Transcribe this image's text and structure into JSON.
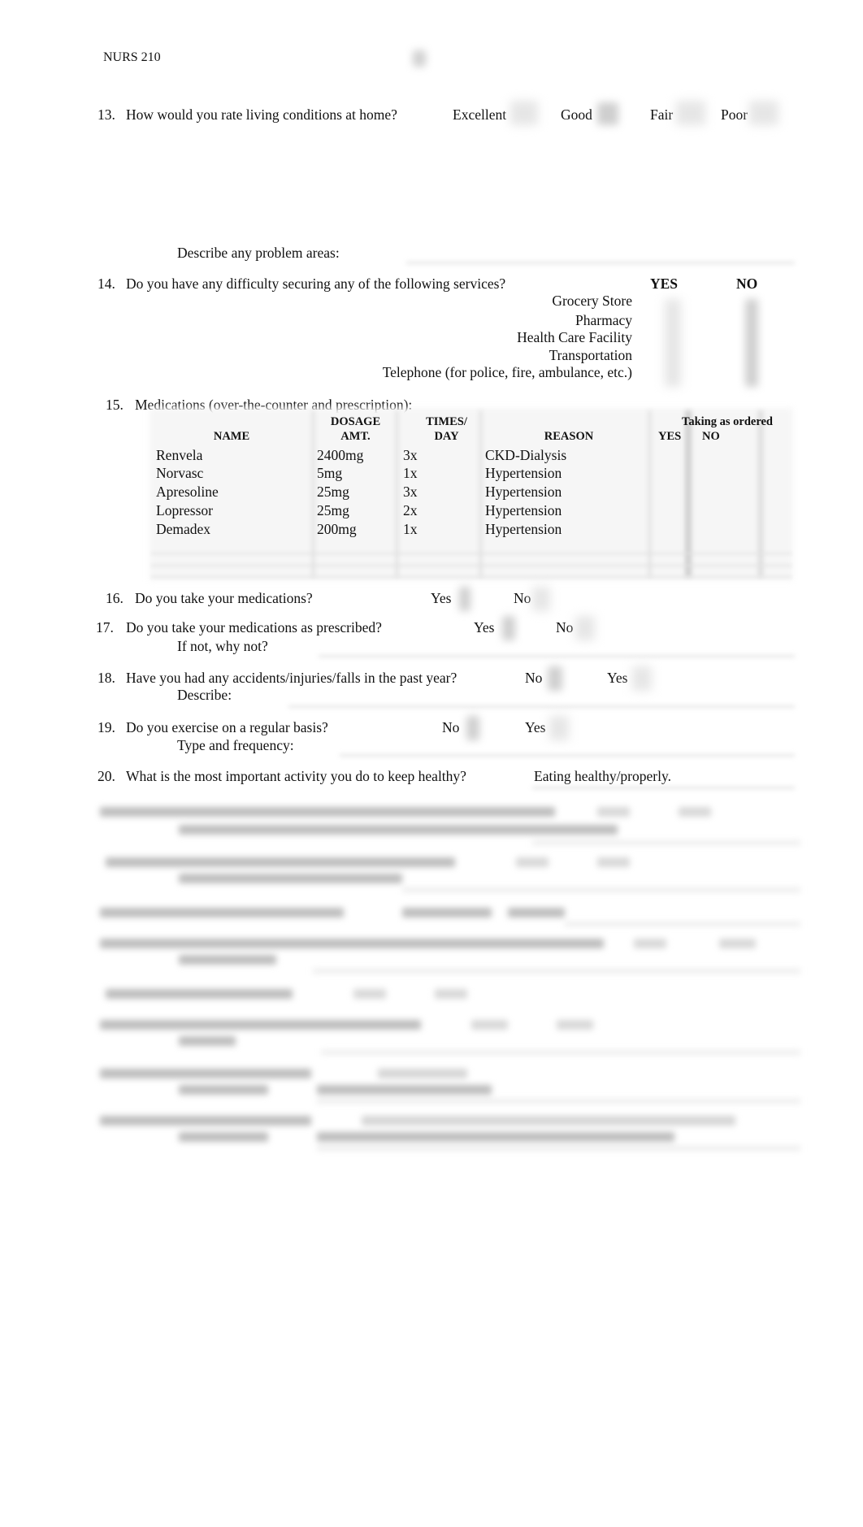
{
  "header": {
    "course": "NURS 210"
  },
  "q13": {
    "number": "13.",
    "question": "How would you rate living conditions at home?",
    "options": [
      "Excellent",
      "Good",
      "Fair",
      "Poor"
    ],
    "describe_label": "Describe any problem areas:"
  },
  "q14": {
    "number": "14.",
    "question": "Do you have any difficulty securing any of the following services?",
    "col_yes": "YES",
    "col_no": "NO",
    "services": [
      "Grocery Store",
      "Pharmacy",
      "Health Care Facility",
      "Transportation",
      "Telephone (for police, fire, ambulance, etc.)"
    ]
  },
  "q15": {
    "number": "15.",
    "question": "Medications (over-the-counter and prescription):",
    "headers": {
      "name": "NAME",
      "dosage_line1": "DOSAGE",
      "dosage_line2": "AMT.",
      "times_line1": "TIMES/",
      "times_line2": "DAY",
      "reason": "REASON",
      "taking": "Taking as ordered",
      "yes": "YES",
      "no": "NO"
    },
    "rows": [
      {
        "name": "Renvela",
        "dosage": "2400mg",
        "times": "3x",
        "reason": "CKD-Dialysis"
      },
      {
        "name": "Norvasc",
        "dosage": "5mg",
        "times": "1x",
        "reason": "Hypertension"
      },
      {
        "name": "Apresoline",
        "dosage": "25mg",
        "times": "3x",
        "reason": "Hypertension"
      },
      {
        "name": "Lopressor",
        "dosage": "25mg",
        "times": "2x",
        "reason": "Hypertension"
      },
      {
        "name": "Demadex",
        "dosage": "200mg",
        "times": "1x",
        "reason": "Hypertension"
      }
    ]
  },
  "q16": {
    "number": "16.",
    "question": "Do you take your medications?",
    "opt1": "Yes",
    "opt2": "No"
  },
  "q17": {
    "number": "17.",
    "question": "Do you take your medications as prescribed?",
    "opt1": "Yes",
    "opt2": "No",
    "followup": "If not, why not?"
  },
  "q18": {
    "number": "18.",
    "question": "Have you had any accidents/injuries/falls in the past year?",
    "opt1": "No",
    "opt2": "Yes",
    "followup": "Describe:"
  },
  "q19": {
    "number": "19.",
    "question": "Do you exercise on a regular basis?",
    "opt1": "No",
    "opt2": "Yes",
    "followup": "Type and frequency:"
  },
  "q20": {
    "number": "20.",
    "question": "What is the most important activity you do to keep healthy?",
    "answer": "Eating healthy/properly."
  }
}
